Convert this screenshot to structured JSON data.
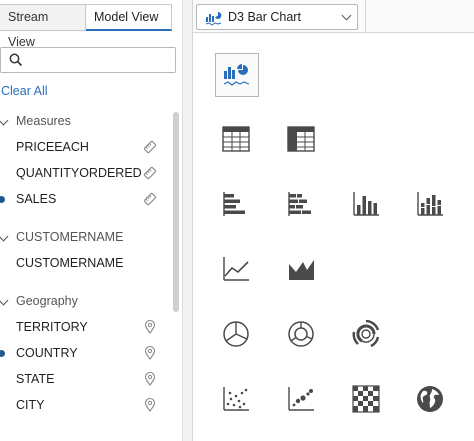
{
  "tabs": {
    "stream": "Stream View",
    "model": "Model View",
    "active": "model"
  },
  "search": {
    "placeholder": "",
    "value": ""
  },
  "clear_all": "Clear All",
  "groups": [
    {
      "label": "Measures",
      "items": [
        {
          "label": "PRICEEACH",
          "icon": "measure-tag-icon",
          "selected": false
        },
        {
          "label": "QUANTITYORDERED",
          "icon": "measure-tag-icon",
          "selected": false
        },
        {
          "label": "SALES",
          "icon": "measure-tag-icon",
          "selected": true
        }
      ]
    },
    {
      "label": "CUSTOMERNAME",
      "items": [
        {
          "label": "CUSTOMERNAME",
          "icon": "",
          "selected": false
        }
      ]
    },
    {
      "label": "Geography",
      "items": [
        {
          "label": "TERRITORY",
          "icon": "map-pin-icon",
          "selected": false
        },
        {
          "label": "COUNTRY",
          "icon": "map-pin-icon",
          "selected": true
        },
        {
          "label": "STATE",
          "icon": "map-pin-icon",
          "selected": false
        },
        {
          "label": "CITY",
          "icon": "map-pin-icon",
          "selected": false
        }
      ]
    }
  ],
  "chart_select": {
    "label": "D3 Bar Chart",
    "icon": "d3-chart-icon"
  },
  "chart_types": [
    {
      "name": "composite-bar-pie-chart",
      "selected": true
    },
    {
      "name": "table",
      "selected": false
    },
    {
      "name": "table-with-header",
      "selected": false
    },
    {
      "name": "horizontal-bar-chart",
      "selected": false
    },
    {
      "name": "horizontal-stacked-bar-chart",
      "selected": false
    },
    {
      "name": "vertical-bar-chart",
      "selected": false
    },
    {
      "name": "vertical-stacked-bar-chart",
      "selected": false
    },
    {
      "name": "line-chart",
      "selected": false
    },
    {
      "name": "area-chart",
      "selected": false
    },
    {
      "name": "pie-chart",
      "selected": false
    },
    {
      "name": "donut-chart",
      "selected": false
    },
    {
      "name": "sunburst-chart",
      "selected": false
    },
    {
      "name": "scatter-plot",
      "selected": false
    },
    {
      "name": "bubble-scatter-plot",
      "selected": false
    },
    {
      "name": "heat-grid",
      "selected": false
    },
    {
      "name": "geo-map",
      "selected": false
    }
  ],
  "colors": {
    "accent": "#2a6ebb",
    "selected_dot": "#1f5a8f",
    "icon": "#4a4a4a"
  }
}
